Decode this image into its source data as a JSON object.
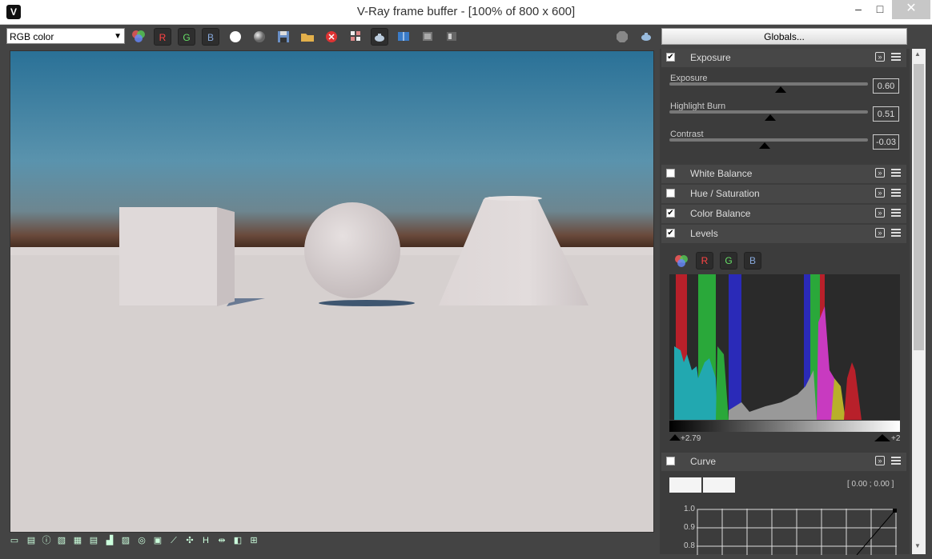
{
  "window": {
    "title": "V-Ray frame buffer - [100% of 800 x 600]",
    "app_icon": "V",
    "minimize": "–",
    "maximize": "□",
    "close": "✕"
  },
  "toolbar": {
    "channel": "RGB color",
    "r_label": "R",
    "g_label": "G",
    "b_label": "B",
    "globals_label": "Globals..."
  },
  "panel": {
    "exposure": {
      "title": "Exposure",
      "checked": true,
      "sliders": [
        {
          "label": "Exposure",
          "value": "0.60",
          "level": 0.52
        },
        {
          "label": "Highlight Burn",
          "value": "0.51",
          "level": 0.51
        },
        {
          "label": "Contrast",
          "value": "-0.03",
          "level": 0.48
        }
      ]
    },
    "white_balance": {
      "title": "White Balance",
      "checked": false
    },
    "hue_saturation": {
      "title": "Hue / Saturation",
      "checked": false
    },
    "color_balance": {
      "title": "Color Balance",
      "checked": true
    },
    "levels": {
      "title": "Levels",
      "checked": true,
      "r_label": "R",
      "g_label": "G",
      "b_label": "B",
      "low_value": "+2.79",
      "high_value": "+2"
    },
    "curve": {
      "title": "Curve",
      "checked": false,
      "coord": "[ 0.00 ; 0.00 ]",
      "y_ticks": [
        "1.0",
        "0.9",
        "0.8"
      ]
    }
  },
  "icons": {
    "check": "✔",
    "expand": "»",
    "colors": {
      "red": "#e04040",
      "green": "#40c040",
      "blue": "#6fa0ff"
    }
  }
}
